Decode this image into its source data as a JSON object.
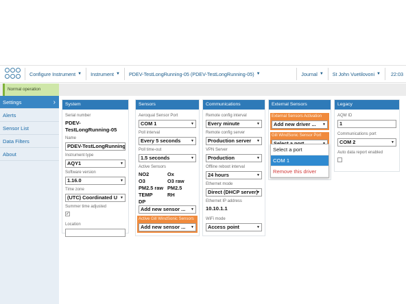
{
  "nav": {
    "configure": "Configure Instrument",
    "instrument": "Instrument",
    "device": "PDEV-TestLongRunning-05 (PDEV-TestLongRunning-05)",
    "journal": "Journal",
    "user": "St John Vuetilovoni",
    "time": "22:03"
  },
  "status": {
    "text": "Normal operation"
  },
  "sidebar": {
    "items": [
      {
        "label": "Settings"
      },
      {
        "label": "Alerts"
      },
      {
        "label": "Sensor List"
      },
      {
        "label": "Data Filters"
      },
      {
        "label": "About"
      }
    ]
  },
  "system": {
    "title": "System",
    "serial_label": "Serial number",
    "serial_value": "PDEV-TestLongRunning-05",
    "name_label": "Name",
    "name_value": "PDEV-TestLongRunning",
    "type_label": "Instrument type",
    "type_value": "AQY1",
    "software_label": "Software version",
    "software_value": "1.16.0",
    "timezone_label": "Time zone",
    "timezone_value": "(UTC) Coordinated U",
    "summer_label": "Summer time adjusted",
    "summer_check": "✓",
    "location_label": "Location",
    "location_value": ""
  },
  "sensors": {
    "title": "Sensors",
    "port_label": "Aeroqual Sensor Port",
    "port_value": "COM 1",
    "poll_label": "Poll interval",
    "poll_value": "Every 5 seconds",
    "timeout_label": "Poll time-out",
    "timeout_value": "1.5 seconds",
    "active_label": "Active Sensors",
    "active": [
      "NO2",
      "Ox",
      "O3",
      "O3 raw",
      "PM2.5 raw",
      "PM2.5",
      "TEMP",
      "RH",
      "DP"
    ],
    "add_value": "Add new sensor ...",
    "gill_label": "Active Gill WindSonic Sensors",
    "gill_value": "Add new sensor ..."
  },
  "communications": {
    "title": "Communications",
    "remote_interval_label": "Remote config interval",
    "remote_interval_value": "Every minute",
    "remote_server_label": "Remote config server",
    "remote_server_value": "Production server",
    "vpn_label": "VPN Server",
    "vpn_value": "Production",
    "reboot_label": "Offline reboot interval",
    "reboot_value": "24 hours",
    "eth_mode_label": "Ethernet mode",
    "eth_mode_value": "Direct (DHCP server)",
    "eth_ip_label": "Ethernet IP address",
    "eth_ip_value": "10.10.1.1",
    "wifi_label": "WiFi mode",
    "wifi_value": "Access point"
  },
  "external": {
    "title": "External Sensors",
    "activation_label": "External Sensors Activation",
    "activation_value": "Add new driver ...",
    "gill_port_label": "Gill WindSonic Sensor Port",
    "gill_port_value": "Select a port",
    "options": [
      "Select a port",
      "COM 1",
      "Remove this driver"
    ]
  },
  "legacy": {
    "title": "Legacy",
    "aqm_label": "AQM ID",
    "aqm_value": "1",
    "comm_port_label": "Communications port",
    "comm_port_value": "COM 2",
    "auto_label": "Auto data report enabled"
  },
  "colors": {
    "header_blue": "#2e7ab8",
    "highlight_orange": "#f08a3c",
    "status_green": "#cfe7a9",
    "selected_option": "#2f8ad0",
    "remove_red": "#d03a3a"
  }
}
